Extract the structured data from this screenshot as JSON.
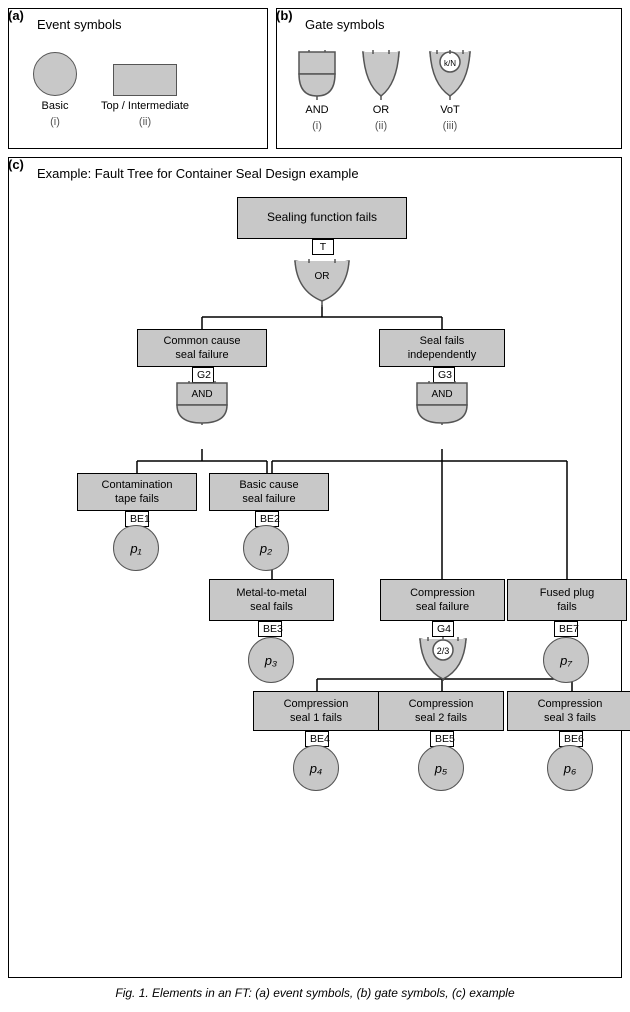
{
  "panels": {
    "a_label": "(a)",
    "a_title": "Event symbols",
    "b_label": "(b)",
    "b_title": "Gate symbols",
    "c_label": "(c)",
    "c_title": "Example: Fault Tree  for Container Seal Design example"
  },
  "event_symbols": {
    "basic_label": "Basic",
    "basic_sub": "(i)",
    "intermediate_label": "Top / Intermediate",
    "intermediate_sub": "(ii)"
  },
  "gate_symbols": {
    "and_label": "AND",
    "and_sub": "(i)",
    "or_label": "OR",
    "or_sub": "(ii)",
    "vot_label": "VoT",
    "vot_sub": "(iii)",
    "vot_kn": "k/N"
  },
  "tree_nodes": {
    "top": {
      "text": "Sealing function fails",
      "label": "T"
    },
    "or_gate": "OR",
    "g2_box": {
      "text": "Common cause\nseal failure",
      "label": "G2"
    },
    "g3_box": {
      "text": "Seal fails\nindependently",
      "label": "G3"
    },
    "and_g2": "AND",
    "and_g3": "AND",
    "be1_box": {
      "text": "Contamination\ntape fails",
      "label": "BE1"
    },
    "be2_box": {
      "text": "Basic cause\nseal failure",
      "label": "BE2"
    },
    "p1": "p₁",
    "p2": "p₂",
    "be3_box": {
      "text": "Metal-to-metal\nseal fails",
      "label": "BE3"
    },
    "g4_box": {
      "text": "Compression\nseal failure",
      "label": "G4"
    },
    "be7_box": {
      "text": "Fused plug\nfails",
      "label": "BE7"
    },
    "p3": "p₃",
    "vot_g4": "2/3",
    "p7": "p₇",
    "be4_box": {
      "text": "Compression\nseal 1 fails",
      "label": "BE4"
    },
    "be5_box": {
      "text": "Compression\nseal 2 fails",
      "label": "BE5"
    },
    "be6_box": {
      "text": "Compression\nseal 3 fails",
      "label": "BE6"
    },
    "p4": "p₄",
    "p5": "p₅",
    "p6": "p₆"
  },
  "caption": "Fig. 1. Elements in an FT: (a) event symbols, (b) gate symbols, (c) example"
}
